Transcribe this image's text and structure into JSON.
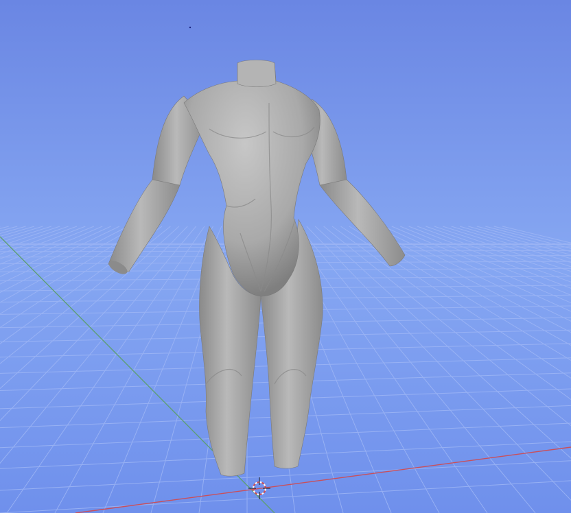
{
  "app": {
    "name": "3D viewport"
  },
  "viewport": {
    "background_top": "#6a86e3",
    "background_mid": "#86a7f2",
    "background_bottom": "#6f90ec",
    "grid_line": "#9eb6f5",
    "axis_x_color": "#c94f5b",
    "axis_y_color": "#5e9f76",
    "model_fill": "#a9a9a9",
    "model_shadow": "#7f7f7f",
    "model_highlight": "#c7c7c7",
    "cursor_ring": "#ffffff",
    "cursor_accent": "#c94f5b"
  },
  "icons": {
    "cursor": "3d-cursor-icon"
  }
}
